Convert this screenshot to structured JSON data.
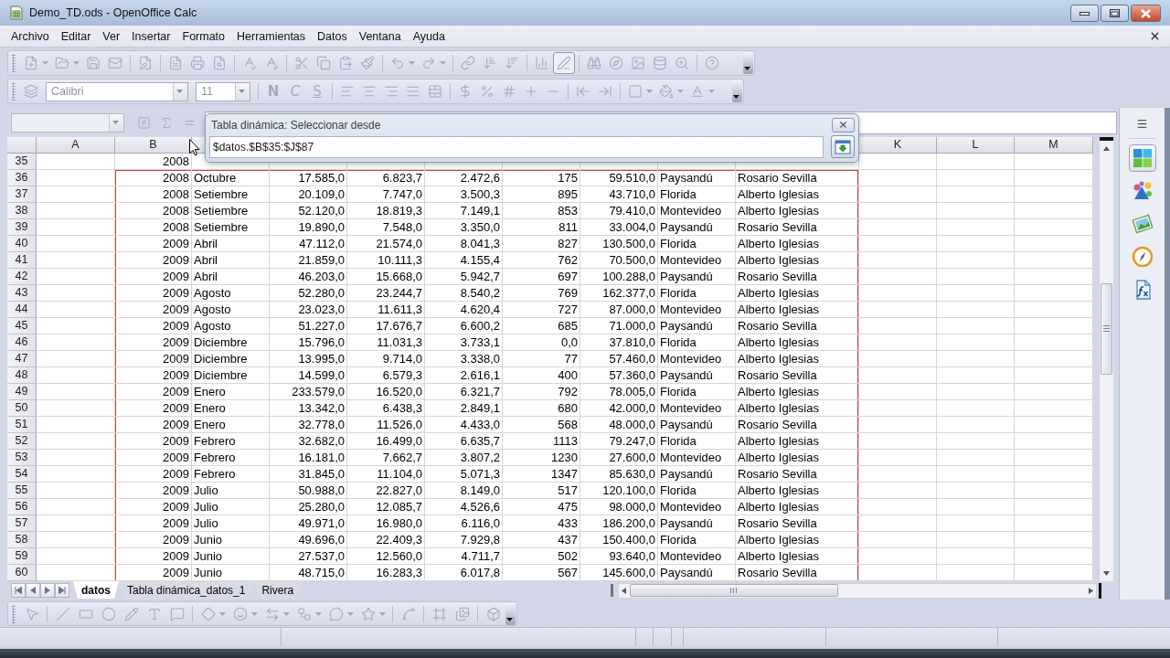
{
  "window": {
    "title": "Demo_TD.ods - OpenOffice Calc"
  },
  "menu": [
    "Archivo",
    "Editar",
    "Ver",
    "Insertar",
    "Formato",
    "Herramientas",
    "Datos",
    "Ventana",
    "Ayuda"
  ],
  "standard_toolbar": {
    "disabled": true,
    "pen_button": {
      "on": true
    }
  },
  "formatting_toolbar": {
    "disabled": true,
    "font_name": "Calibri",
    "font_size": "11",
    "style_buttons": [
      "N",
      "C",
      "S"
    ]
  },
  "formula_bar": {
    "disabled": true
  },
  "column_headers": [
    "A",
    "B",
    "K",
    "L",
    "M"
  ],
  "rows": [
    {
      "number": "35",
      "in_range": false,
      "cells": [
        "2008"
      ]
    },
    {
      "number": "36",
      "in_range": true,
      "cells": [
        "2008",
        "Octubre",
        "17.585,0",
        "6.823,7",
        "2.472,6",
        "175",
        "59.510,0",
        "Paysandú",
        "Rosario Sevilla"
      ]
    },
    {
      "number": "37",
      "in_range": true,
      "cells": [
        "2008",
        "Setiembre",
        "20.109,0",
        "7.747,0",
        "3.500,3",
        "895",
        "43.710,0",
        "Florida",
        "Alberto Iglesias"
      ]
    },
    {
      "number": "38",
      "in_range": true,
      "cells": [
        "2008",
        "Setiembre",
        "52.120,0",
        "18.819,3",
        "7.149,1",
        "853",
        "79.410,0",
        "Montevideo",
        "Alberto Iglesias"
      ]
    },
    {
      "number": "39",
      "in_range": true,
      "cells": [
        "2008",
        "Setiembre",
        "19.890,0",
        "7.548,0",
        "3.350,0",
        "811",
        "33.004,0",
        "Paysandú",
        "Rosario Sevilla"
      ]
    },
    {
      "number": "40",
      "in_range": true,
      "cells": [
        "2009",
        "Abril",
        "47.112,0",
        "21.574,0",
        "8.041,3",
        "827",
        "130.500,0",
        "Florida",
        "Alberto Iglesias"
      ]
    },
    {
      "number": "41",
      "in_range": true,
      "cells": [
        "2009",
        "Abril",
        "21.859,0",
        "10.111,3",
        "4.155,4",
        "762",
        "70.500,0",
        "Montevideo",
        "Alberto Iglesias"
      ]
    },
    {
      "number": "42",
      "in_range": true,
      "cells": [
        "2009",
        "Abril",
        "46.203,0",
        "15.668,0",
        "5.942,7",
        "697",
        "100.288,0",
        "Paysandú",
        "Rosario Sevilla"
      ]
    },
    {
      "number": "43",
      "in_range": true,
      "cells": [
        "2009",
        "Agosto",
        "52.280,0",
        "23.244,7",
        "8.540,2",
        "769",
        "162.377,0",
        "Florida",
        "Alberto Iglesias"
      ]
    },
    {
      "number": "44",
      "in_range": true,
      "cells": [
        "2009",
        "Agosto",
        "23.023,0",
        "11.611,3",
        "4.620,4",
        "727",
        "87.000,0",
        "Montevideo",
        "Alberto Iglesias"
      ]
    },
    {
      "number": "45",
      "in_range": true,
      "cells": [
        "2009",
        "Agosto",
        "51.227,0",
        "17.676,7",
        "6.600,2",
        "685",
        "71.000,0",
        "Paysandú",
        "Rosario Sevilla"
      ]
    },
    {
      "number": "46",
      "in_range": true,
      "cells": [
        "2009",
        "Diciembre",
        "15.796,0",
        "11.031,3",
        "3.733,1",
        "0,0",
        "37.810,0",
        "Florida",
        "Alberto Iglesias"
      ]
    },
    {
      "number": "47",
      "in_range": true,
      "cells": [
        "2009",
        "Diciembre",
        "13.995,0",
        "9.714,0",
        "3.338,0",
        "77",
        "57.460,0",
        "Montevideo",
        "Alberto Iglesias"
      ]
    },
    {
      "number": "48",
      "in_range": true,
      "cells": [
        "2009",
        "Diciembre",
        "14.599,0",
        "6.579,3",
        "2.616,1",
        "400",
        "57.360,0",
        "Paysandú",
        "Rosario Sevilla"
      ]
    },
    {
      "number": "49",
      "in_range": true,
      "cells": [
        "2009",
        "Enero",
        "233.579,0",
        "16.520,0",
        "6.321,7",
        "792",
        "78.005,0",
        "Florida",
        "Alberto Iglesias"
      ]
    },
    {
      "number": "50",
      "in_range": true,
      "cells": [
        "2009",
        "Enero",
        "13.342,0",
        "6.438,3",
        "2.849,1",
        "680",
        "42.000,0",
        "Montevideo",
        "Alberto Iglesias"
      ]
    },
    {
      "number": "51",
      "in_range": true,
      "cells": [
        "2009",
        "Enero",
        "32.778,0",
        "11.526,0",
        "4.433,0",
        "568",
        "48.000,0",
        "Paysandú",
        "Rosario Sevilla"
      ]
    },
    {
      "number": "52",
      "in_range": true,
      "cells": [
        "2009",
        "Febrero",
        "32.682,0",
        "16.499,0",
        "6.635,7",
        "1113",
        "79.247,0",
        "Florida",
        "Alberto Iglesias"
      ]
    },
    {
      "number": "53",
      "in_range": true,
      "cells": [
        "2009",
        "Febrero",
        "16.181,0",
        "7.662,7",
        "3.807,2",
        "1230",
        "27.600,0",
        "Montevideo",
        "Alberto Iglesias"
      ]
    },
    {
      "number": "54",
      "in_range": true,
      "cells": [
        "2009",
        "Febrero",
        "31.845,0",
        "11.104,0",
        "5.071,3",
        "1347",
        "85.630,0",
        "Paysandú",
        "Rosario Sevilla"
      ]
    },
    {
      "number": "55",
      "in_range": true,
      "cells": [
        "2009",
        "Julio",
        "50.988,0",
        "22.827,0",
        "8.149,0",
        "517",
        "120.100,0",
        "Florida",
        "Alberto Iglesias"
      ]
    },
    {
      "number": "56",
      "in_range": true,
      "cells": [
        "2009",
        "Julio",
        "25.280,0",
        "12.085,7",
        "4.526,6",
        "475",
        "98.000,0",
        "Montevideo",
        "Alberto Iglesias"
      ]
    },
    {
      "number": "57",
      "in_range": true,
      "cells": [
        "2009",
        "Julio",
        "49.971,0",
        "16.980,0",
        "6.116,0",
        "433",
        "186.200,0",
        "Paysandú",
        "Rosario Sevilla"
      ]
    },
    {
      "number": "58",
      "in_range": true,
      "cells": [
        "2009",
        "Junio",
        "49.696,0",
        "22.409,3",
        "7.929,8",
        "437",
        "150.400,0",
        "Florida",
        "Alberto Iglesias"
      ]
    },
    {
      "number": "59",
      "in_range": true,
      "cells": [
        "2009",
        "Junio",
        "27.537,0",
        "12.560,0",
        "4.711,7",
        "502",
        "93.640,0",
        "Montevideo",
        "Alberto Iglesias"
      ]
    },
    {
      "number": "60",
      "in_range": true,
      "cells": [
        "2009",
        "Junio",
        "48.715,0",
        "16.283,3",
        "6.017,8",
        "567",
        "145.600,0",
        "Paysandú",
        "Rosario Sevilla"
      ]
    }
  ],
  "pivot_dialog": {
    "title": "Tabla dinámica: Seleccionar desde",
    "value": "$datos.$B$35:$J$87"
  },
  "sheet_tabs": [
    {
      "label": "datos",
      "selected": true
    },
    {
      "label": "Tabla dinámica_datos_1",
      "selected": false
    },
    {
      "label": "Rivera",
      "selected": false
    }
  ],
  "sidebar": {
    "tabs": [
      {
        "kind": "properties",
        "selected": true
      },
      {
        "kind": "styles",
        "selected": false
      },
      {
        "kind": "gallery",
        "selected": false
      },
      {
        "kind": "navigator",
        "selected": false
      },
      {
        "kind": "functions",
        "selected": false
      }
    ]
  },
  "drawing_toolbar": {
    "disabled": true
  }
}
